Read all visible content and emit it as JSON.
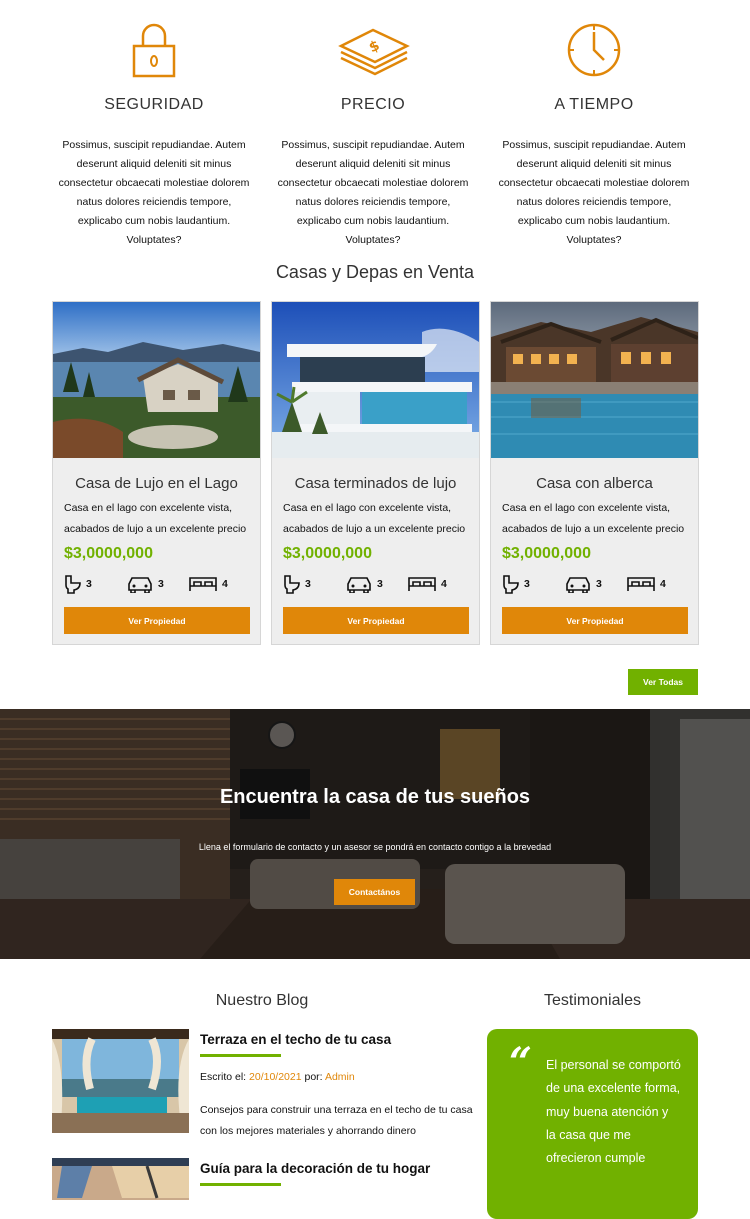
{
  "features": [
    {
      "icon": "lock-icon",
      "title": "SEGURIDAD",
      "text": "Possimus, suscipit repudiandae. Autem deserunt aliquid deleniti sit minus consectetur obcaecati molestiae dolorem natus dolores reiciendis tempore, explicabo cum nobis laudantium. Voluptates?"
    },
    {
      "icon": "money-stack-icon",
      "title": "PRECIO",
      "text": "Possimus, suscipit repudiandae. Autem deserunt aliquid deleniti sit minus consectetur obcaecati molestiae dolorem natus dolores reiciendis tempore, explicabo cum nobis laudantium. Voluptates?"
    },
    {
      "icon": "clock-icon",
      "title": "A TIEMPO",
      "text": "Possimus, suscipit repudiandae. Autem deserunt aliquid deleniti sit minus consectetur obcaecati molestiae dolorem natus dolores reiciendis tempore, explicabo cum nobis laudantium. Voluptates?"
    }
  ],
  "listings": {
    "title": "Casas y Depas en Venta",
    "cards": [
      {
        "title": "Casa de Lujo en el Lago",
        "description": "Casa en el lago con excelente vista, acabados de lujo a un excelente precio",
        "price": "$3,0000,000",
        "bathrooms": "3",
        "parking": "3",
        "bedrooms": "4",
        "button": "Ver Propiedad"
      },
      {
        "title": "Casa terminados de lujo",
        "description": "Casa en el lago con excelente vista, acabados de lujo a un excelente precio",
        "price": "$3,0000,000",
        "bathrooms": "3",
        "parking": "3",
        "bedrooms": "4",
        "button": "Ver Propiedad"
      },
      {
        "title": "Casa con alberca",
        "description": "Casa en el lago con excelente vista, acabados de lujo a un excelente precio",
        "price": "$3,0000,000",
        "bathrooms": "3",
        "parking": "3",
        "bedrooms": "4",
        "button": "Ver Propiedad"
      }
    ],
    "see_all": "Ver Todas"
  },
  "hero": {
    "title": "Encuentra la casa de tus sueños",
    "subtitle": "Llena el formulario de contacto y un asesor se pondrá en contacto contigo a la brevedad",
    "button": "Contactános"
  },
  "blog": {
    "title": "Nuestro Blog",
    "posts": [
      {
        "title": "Terraza en el techo de tu casa",
        "meta_prefix": "Escrito el: ",
        "date": "20/10/2021",
        "meta_by": " por: ",
        "author": "Admin",
        "excerpt": "Consejos para construir una terraza en el techo de tu casa con los mejores materiales y ahorrando dinero"
      },
      {
        "title": "Guía para la decoración de tu hogar"
      }
    ]
  },
  "testimonials": {
    "title": "Testimoniales",
    "quote_mark": "“",
    "text": "El personal se comportó de una excelente forma, muy buena atención y la casa que me ofrecieron cumple"
  },
  "colors": {
    "accent_orange": "#e08709",
    "accent_green": "#71b100"
  }
}
